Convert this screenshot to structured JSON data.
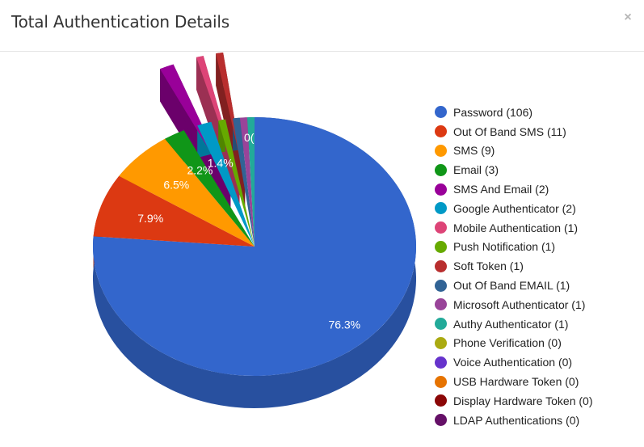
{
  "modal": {
    "title": "Total Authentication Details",
    "close_icon": "close-icon",
    "close_glyph": "×"
  },
  "chart_data": {
    "type": "pie",
    "title": "Total Authentication Details",
    "is3D": true,
    "legend_position": "right",
    "slices": [
      {
        "label": "Password",
        "value": 106,
        "color": "#3366cc",
        "percent_label": "76.3%",
        "exploded": false
      },
      {
        "label": "Out Of Band SMS",
        "value": 11,
        "color": "#dc3912",
        "percent_label": "7.9%",
        "exploded": false
      },
      {
        "label": "SMS",
        "value": 9,
        "color": "#ff9900",
        "percent_label": "6.5%",
        "exploded": false
      },
      {
        "label": "Email",
        "value": 3,
        "color": "#109618",
        "percent_label": "2.2%",
        "exploded": false
      },
      {
        "label": "SMS And Email",
        "value": 2,
        "color": "#990099",
        "percent_label": "",
        "exploded": true
      },
      {
        "label": "Google Authenticator",
        "value": 2,
        "color": "#0099c6",
        "percent_label": "1.4%",
        "exploded": false
      },
      {
        "label": "Mobile Authentication",
        "value": 1,
        "color": "#dd4477",
        "percent_label": "",
        "exploded": true
      },
      {
        "label": "Push Notification",
        "value": 1,
        "color": "#66aa00",
        "percent_label": "",
        "exploded": false
      },
      {
        "label": "Soft Token",
        "value": 1,
        "color": "#b82e2e",
        "percent_label": "",
        "exploded": true
      },
      {
        "label": "Out Of Band EMAIL",
        "value": 1,
        "color": "#316395",
        "percent_label": "",
        "exploded": false
      },
      {
        "label": "Microsoft Authenticator",
        "value": 1,
        "color": "#994499",
        "percent_label": "",
        "exploded": false
      },
      {
        "label": "Authy Authenticator",
        "value": 1,
        "color": "#22aa99",
        "percent_label": "",
        "exploded": false
      },
      {
        "label": "Phone Verification",
        "value": 0,
        "color": "#aaaa11",
        "percent_label": "",
        "exploded": false
      },
      {
        "label": "Voice Authentication",
        "value": 0,
        "color": "#6633cc",
        "percent_label": "",
        "exploded": false
      },
      {
        "label": "USB Hardware Token",
        "value": 0,
        "color": "#e67300",
        "percent_label": "",
        "exploded": false
      },
      {
        "label": "Display Hardware Token",
        "value": 0,
        "color": "#8b0707",
        "percent_label": "",
        "exploded": false
      },
      {
        "label": "LDAP Authentications",
        "value": 0,
        "color": "#651067",
        "percent_label": "",
        "exploded": false
      }
    ],
    "clipped_label": "0("
  },
  "legend": {
    "items": [
      {
        "text": "Password (106)",
        "color": "#3366cc"
      },
      {
        "text": "Out Of Band SMS (11)",
        "color": "#dc3912"
      },
      {
        "text": "SMS (9)",
        "color": "#ff9900"
      },
      {
        "text": "Email (3)",
        "color": "#109618"
      },
      {
        "text": "SMS And Email (2)",
        "color": "#990099"
      },
      {
        "text": "Google Authenticator (2)",
        "color": "#0099c6"
      },
      {
        "text": "Mobile Authentication (1)",
        "color": "#dd4477"
      },
      {
        "text": "Push Notification (1)",
        "color": "#66aa00"
      },
      {
        "text": "Soft Token (1)",
        "color": "#b82e2e"
      },
      {
        "text": "Out Of Band EMAIL (1)",
        "color": "#316395"
      },
      {
        "text": "Microsoft Authenticator (1)",
        "color": "#994499"
      },
      {
        "text": "Authy Authenticator (1)",
        "color": "#22aa99"
      },
      {
        "text": "Phone Verification (0)",
        "color": "#aaaa11"
      },
      {
        "text": "Voice Authentication (0)",
        "color": "#6633cc"
      },
      {
        "text": "USB Hardware Token (0)",
        "color": "#e67300"
      },
      {
        "text": "Display Hardware Token (0)",
        "color": "#8b0707"
      },
      {
        "text": "LDAP Authentications (0)",
        "color": "#651067"
      }
    ]
  }
}
